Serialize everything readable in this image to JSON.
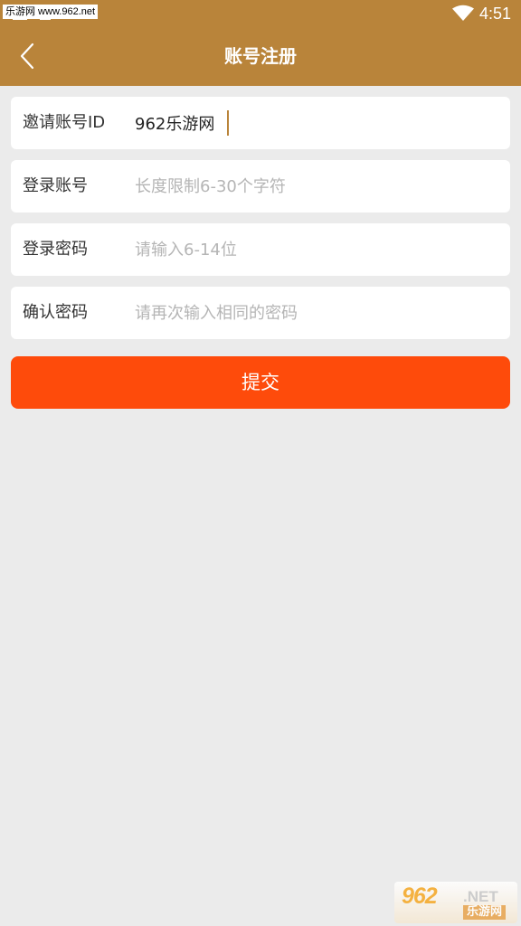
{
  "status_bar": {
    "watermark_text": "乐游网 www.962.net",
    "time": "4:51"
  },
  "app_bar": {
    "title": "账号注册"
  },
  "form": {
    "invite": {
      "label": "邀请账号ID",
      "value": "962乐游网"
    },
    "account": {
      "label": "登录账号",
      "placeholder": "长度限制6-30个字符"
    },
    "password": {
      "label": "登录密码",
      "placeholder": "请输入6-14位"
    },
    "confirm": {
      "label": "确认密码",
      "placeholder": "请再次输入相同的密码"
    },
    "submit_label": "提交"
  },
  "watermark_logo": {
    "number": "962",
    "suffix": ".NET",
    "name": "乐游网"
  },
  "colors": {
    "app_bar": "#b9843a",
    "background": "#ebebeb",
    "submit": "#fe4b0b"
  }
}
